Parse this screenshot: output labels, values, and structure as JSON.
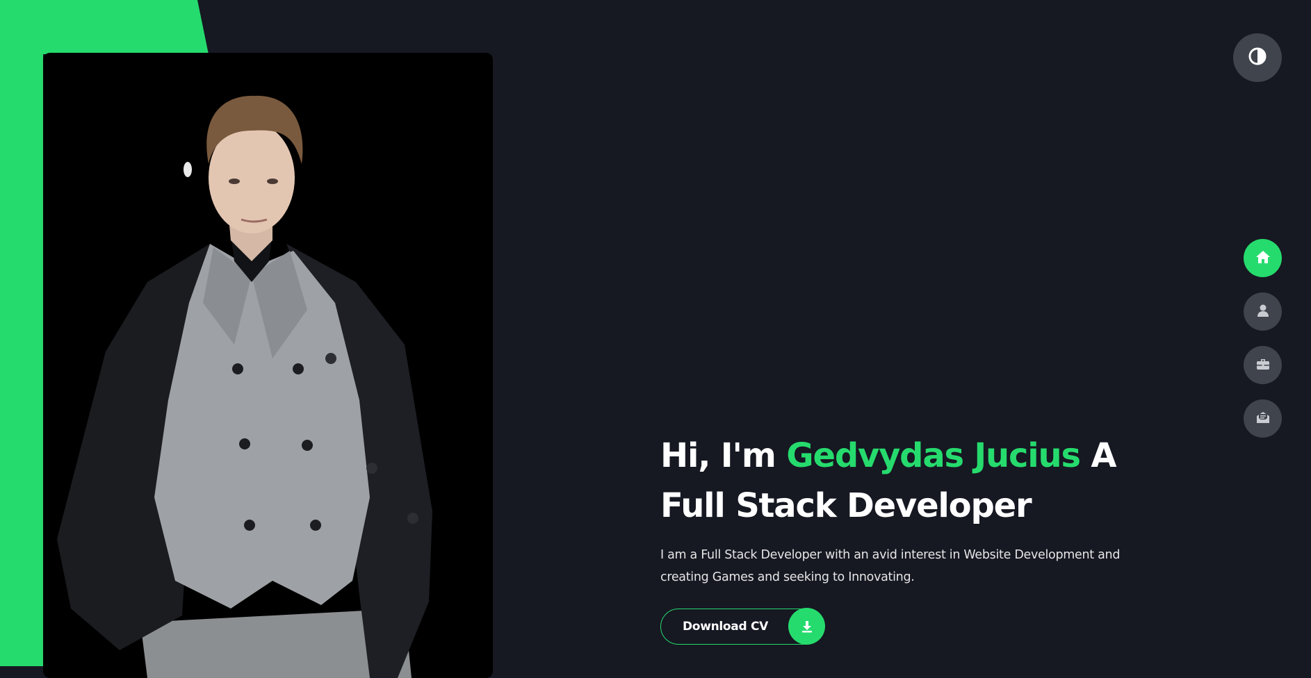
{
  "theme": {
    "accent": "#26db6d",
    "background": "#161822",
    "icon_button_bg": "#40444d",
    "card_bg": "#000000"
  },
  "theme_toggle": {
    "icon": "contrast-icon"
  },
  "profile_photo": {
    "description_icon": "portrait-photo"
  },
  "nav": [
    {
      "icon": "home-icon",
      "active": true
    },
    {
      "icon": "user-icon",
      "active": false
    },
    {
      "icon": "briefcase-icon",
      "active": false
    },
    {
      "icon": "mail-icon",
      "active": false
    }
  ],
  "hero": {
    "greeting": "Hi, I'm ",
    "name": "Gedvydas Jucius",
    "title_rest": " A Full Stack Developer",
    "description": "I am a Full Stack Developer with an avid interest in Website Development and creating Games and seeking to Innovating."
  },
  "download_cv": {
    "label": "Download CV",
    "icon": "download-icon"
  }
}
